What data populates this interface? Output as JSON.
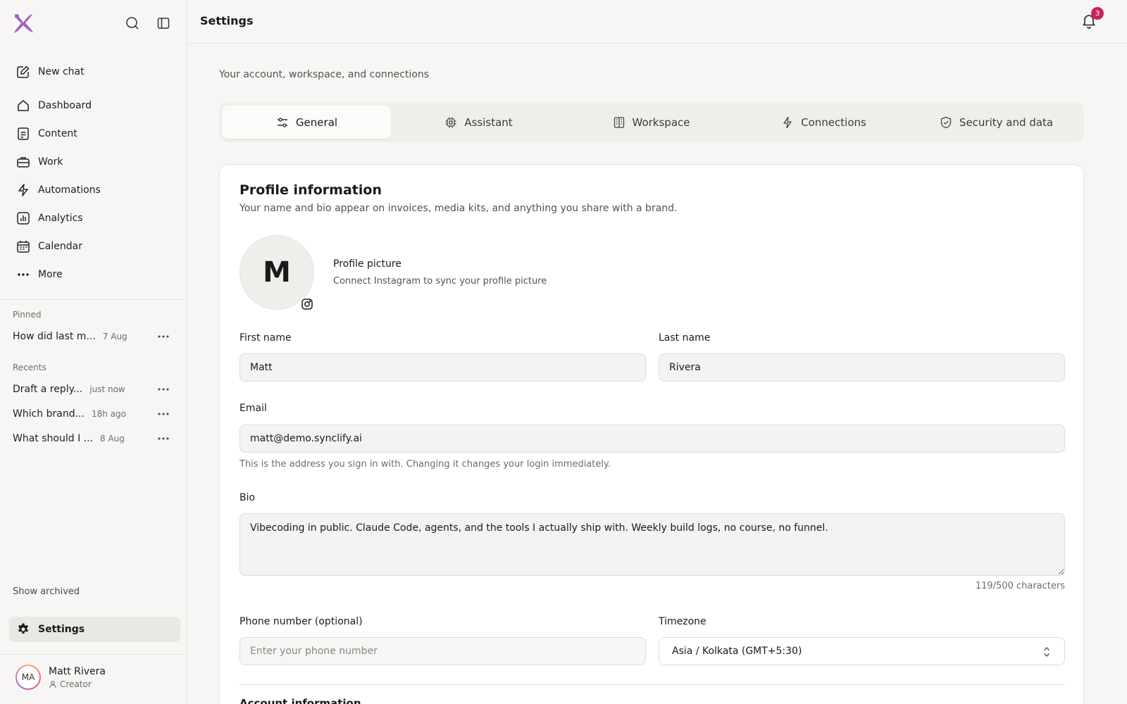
{
  "sidebar": {
    "nav": [
      {
        "label": "New chat",
        "icon": "edit-icon"
      },
      {
        "label": "Dashboard",
        "icon": "home-icon"
      },
      {
        "label": "Content",
        "icon": "document-icon"
      },
      {
        "label": "Work",
        "icon": "briefcase-icon"
      },
      {
        "label": "Automations",
        "icon": "lightning-icon"
      },
      {
        "label": "Analytics",
        "icon": "analytics-icon"
      },
      {
        "label": "Calendar",
        "icon": "calendar-icon"
      },
      {
        "label": "More",
        "icon": "more-icon"
      }
    ],
    "pinned_label": "Pinned",
    "pinned": [
      {
        "title": "How did last m...",
        "time": "7 Aug"
      }
    ],
    "recents_label": "Recents",
    "recents": [
      {
        "title": "Draft a reply...",
        "time": "just now"
      },
      {
        "title": "Which brand...",
        "time": "18h ago"
      },
      {
        "title": "What should I ...",
        "time": "8 Aug"
      }
    ],
    "show_archived": "Show archived",
    "settings_label": "Settings",
    "user": {
      "initials": "MA",
      "name": "Matt Rivera",
      "role": "Creator"
    }
  },
  "header": {
    "title": "Settings",
    "notification_count": "3"
  },
  "main": {
    "subtitle": "Your account, workspace, and connections",
    "tabs": [
      {
        "label": "General",
        "icon": "sliders-icon",
        "active": true
      },
      {
        "label": "Assistant",
        "icon": "chip-icon",
        "active": false
      },
      {
        "label": "Workspace",
        "icon": "building-icon",
        "active": false
      },
      {
        "label": "Connections",
        "icon": "lightning-icon",
        "active": false
      },
      {
        "label": "Security and data",
        "icon": "shield-icon",
        "active": false
      }
    ],
    "profile": {
      "title": "Profile information",
      "description": "Your name and bio appear on invoices, media kits, and anything you share with a brand.",
      "avatar_letter": "M",
      "picture_title": "Profile picture",
      "picture_subtitle": "Connect Instagram to sync your profile picture",
      "first_name_label": "First name",
      "first_name": "Matt",
      "last_name_label": "Last name",
      "last_name": "Rivera",
      "email_label": "Email",
      "email": "matt@demo.synclify.ai",
      "email_help": "This is the address you sign in with. Changing it changes your login immediately.",
      "bio_label": "Bio",
      "bio": "Vibecoding in public. Claude Code, agents, and the tools I actually ship with. Weekly build logs, no course, no funnel.",
      "bio_counter": "119/500 characters",
      "phone_label": "Phone number (optional)",
      "phone_placeholder": "Enter your phone number",
      "timezone_label": "Timezone",
      "timezone": "Asia / Kolkata (GMT+5:30)",
      "next_section": "Account information"
    }
  },
  "colors": {
    "accent_logo": "#a05fc9",
    "badge": "#c8245b",
    "background": "#f7f6f4"
  }
}
